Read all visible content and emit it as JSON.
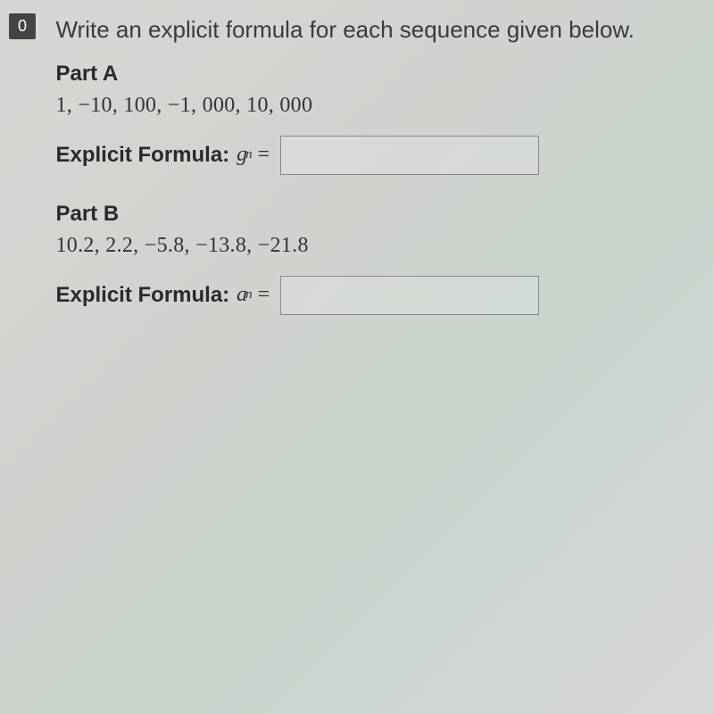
{
  "question": {
    "number": "0",
    "instruction": "Write an explicit formula for each sequence given below."
  },
  "partA": {
    "label": "Part A",
    "sequence": "1, −10, 100, −1, 000, 10, 000",
    "formula_label": "Explicit Formula:",
    "var_letter": "g",
    "var_sub": "n",
    "eq": "="
  },
  "partB": {
    "label": "Part B",
    "sequence": "10.2, 2.2, −5.8, −13.8, −21.8",
    "formula_label": "Explicit Formula:",
    "var_letter": "a",
    "var_sub": "n",
    "eq": "="
  }
}
